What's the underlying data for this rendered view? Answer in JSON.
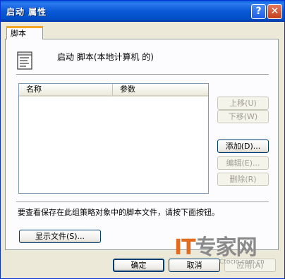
{
  "window": {
    "title": "启动 属性",
    "help_glyph": "?",
    "close_glyph": "✕"
  },
  "tab": {
    "label": "脚本"
  },
  "header": {
    "label": "启动 脚本(本地计算机 的)",
    "icon": "script-icon"
  },
  "list": {
    "columns": [
      "名称",
      "参数"
    ],
    "rows": []
  },
  "side_buttons": {
    "up": "上移(U)",
    "down": "下移(W)",
    "add": "添加(D)...",
    "edit": "编辑(E)...",
    "remove": "删除(R)"
  },
  "hint_text": "要查看保存在此组策略对象中的脚本文件，请按下面按钮。",
  "show_files_button": "显示文件(S)...",
  "footer": {
    "ok": "确定",
    "cancel": "取消",
    "apply": "应用(A)"
  },
  "watermark": {
    "logo_it": "IT",
    "logo_text": "专家网",
    "site": "Ctocio.com.cn"
  },
  "colors": {
    "titlebar": "#0a58d6",
    "dialog_bg": "#ece9d8",
    "tab_accent": "#f5a623",
    "watermark_it": "#e36b1e"
  }
}
